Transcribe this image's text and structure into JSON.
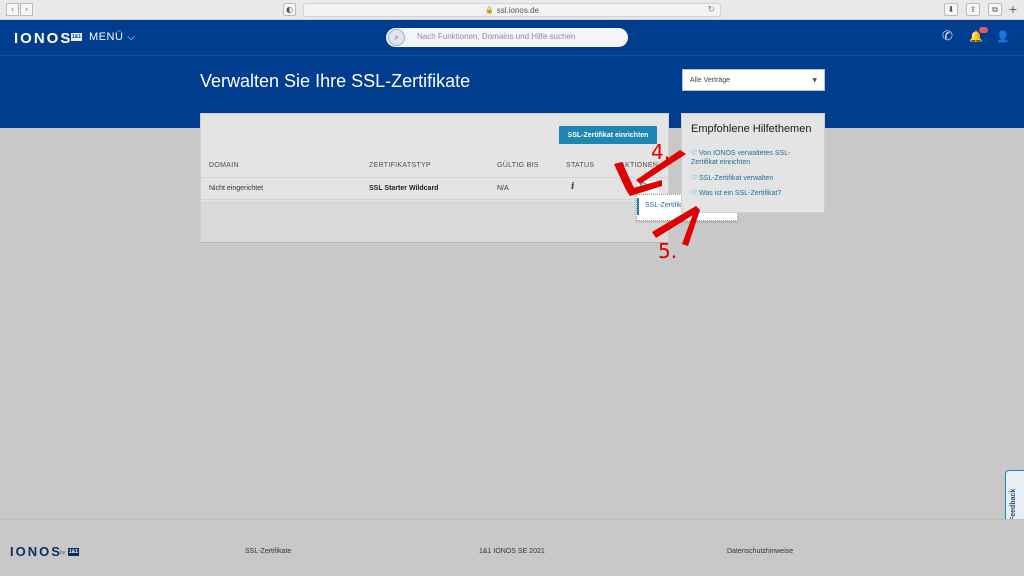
{
  "browser": {
    "url": "ssl.ionos.de",
    "back_icon": "‹",
    "forward_icon": "›",
    "shield_icon": "◐",
    "lock_icon": "🔒",
    "reload_icon": "↻",
    "download_icon": "⬇",
    "share_icon": "⇪",
    "tabs_icon": "⧉",
    "new_tab_icon": "+"
  },
  "header": {
    "logo": "IONOS",
    "logo_by": "by",
    "logo_badge": "1&1",
    "menu_label": "MENÜ",
    "menu_chevron": "⌵",
    "search_placeholder": "Nach Funktionen, Domains und Hilfe suchen",
    "search_icon": "⌕",
    "phone_icon": "✆",
    "bell_icon": "🔔",
    "user_icon": "👤"
  },
  "page": {
    "title": "Verwalten Sie Ihre SSL-Zertifikate",
    "contract_select": "Alle Verträge",
    "select_arrow": "▼"
  },
  "certificates": {
    "setup_button": "SSL-Zertifikat einrichten",
    "columns": [
      "DOMAIN",
      "ZERTIFIKATSTYP",
      "GÜLTIG BIS",
      "STATUS",
      "AKTIONEN"
    ],
    "rows": [
      {
        "domain": "Nicht eingerichtet",
        "type": "SSL Starter Wildcard",
        "valid_until": "N/A",
        "status_icon": "i"
      }
    ],
    "gear_icon": "⚙",
    "gear_caret": "▼",
    "action_menu_item": "SSL-Zertifikat einrichten"
  },
  "help": {
    "title": "Empfohlene Hilfethemen",
    "link_icon": "♡",
    "links": [
      "Von IONOS verwaltetes SSL-Zertifikat einrichten",
      "SSL-Zertifikat verwalten",
      "Was ist ein SSL-Zertifikat?"
    ]
  },
  "annotations": {
    "step4": "4.",
    "step5": "5."
  },
  "feedback": "Feedback",
  "footer": {
    "logo": "IONOS",
    "logo_by": "by",
    "logo_badge": "1&1",
    "link1": "SSL-Zertifikate",
    "copyright": "1&1 IONOS SE 2021",
    "privacy": "Datenschutzhinweise"
  },
  "colors": {
    "header_blue": "#003d8f",
    "accent": "#1f86b2",
    "annotation_red": "#e00000"
  }
}
